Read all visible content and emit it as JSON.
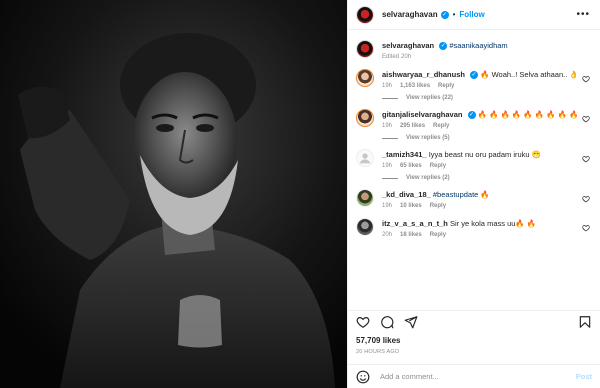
{
  "post": {
    "username": "selvaraghavan",
    "follow_label": "Follow",
    "separator": "•",
    "more_label": "•••"
  },
  "caption": {
    "username": "selvaraghavan",
    "text": "#saanikaayidham",
    "edited": "Edited",
    "time": "20h"
  },
  "comments": [
    {
      "username": "aishwaryaa_r_dhanush",
      "text": "🔥 Woah..! Selva athaan.. 👌",
      "time": "19h",
      "likes": "1,163 likes",
      "reply": "Reply",
      "view_replies": "View replies (22)"
    },
    {
      "username": "gitanjaliselvaraghavan",
      "text": "🔥 🔥 🔥 🔥 🔥 🔥 🔥 🔥 🔥",
      "time": "19h",
      "likes": "295 likes",
      "reply": "Reply",
      "view_replies": "View replies (5)"
    },
    {
      "username": "_tamizh341_",
      "text": "Iyya beast nu oru padam iruku 😁",
      "time": "19h",
      "likes": "65 likes",
      "reply": "Reply",
      "view_replies": "View replies (2)"
    },
    {
      "username": "_kd_diva_18_",
      "text": "#beastupdate 🔥",
      "time": "19h",
      "likes": "10 likes",
      "reply": "Reply"
    },
    {
      "username": "itz_v_a_s_a_n_t_h",
      "text": "Sir ye kola mass uu🔥 🔥",
      "time": "20h",
      "likes": "18 likes",
      "reply": "Reply"
    }
  ],
  "likes_count": "57,709 likes",
  "posted_ago": "20 HOURS AGO",
  "add_comment": {
    "placeholder": "Add a comment...",
    "post_label": "Post"
  },
  "icons": {
    "like": "heart-icon",
    "comment": "comment-icon",
    "share": "share-icon",
    "save": "bookmark-icon",
    "emoji": "emoji-icon",
    "verified": "verified-badge-icon"
  },
  "colors": {
    "accent": "#0095f6",
    "muted": "#8e8e8e",
    "text": "#262626",
    "post_disabled": "#b2dffc"
  }
}
